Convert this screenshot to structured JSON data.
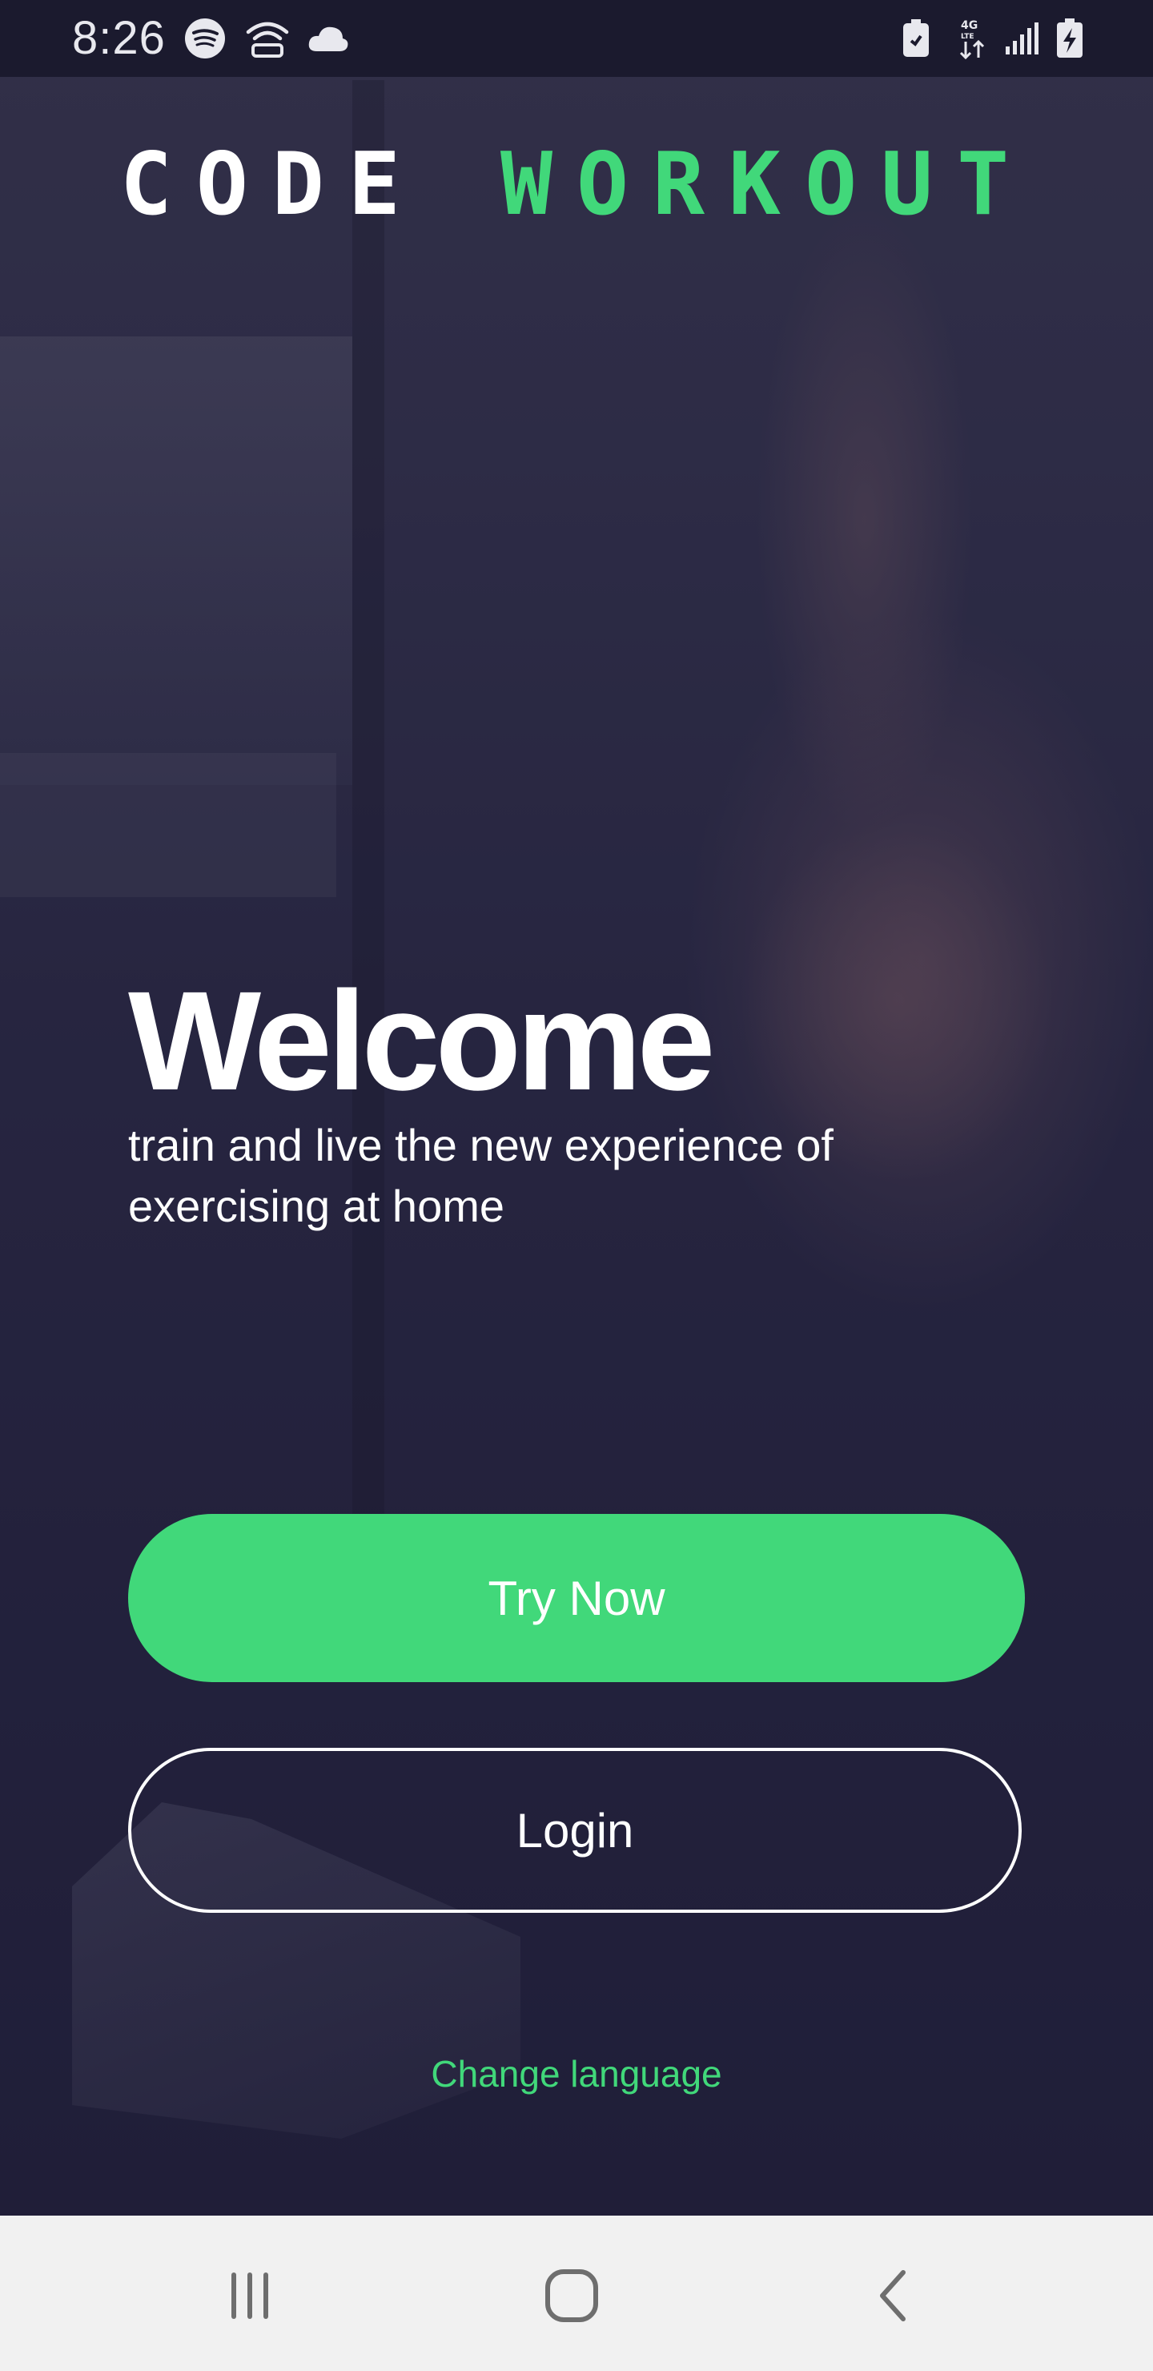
{
  "status_bar": {
    "time": "8:26",
    "left_icons": [
      "spotify-icon",
      "wifi-calling-icon",
      "cloud-icon"
    ],
    "right_icons": [
      "battery-saver-icon",
      "4g-lte-icon",
      "signal-icon",
      "battery-charging-icon"
    ]
  },
  "logo": {
    "part1": "CODE",
    "part2": "WORKOUT"
  },
  "welcome": {
    "title": "Welcome",
    "subtitle": "train and live the new experience of\n exercising at home"
  },
  "buttons": {
    "try_now": "Try Now",
    "login": "Login"
  },
  "links": {
    "change_language": "Change language"
  },
  "nav_bar": {
    "items": [
      "recent-apps-icon",
      "home-icon",
      "back-icon"
    ]
  },
  "colors": {
    "accent": "#41d87a",
    "background": "#25243f",
    "text": "#ffffff",
    "nav_bar": "#f1f1f1"
  }
}
